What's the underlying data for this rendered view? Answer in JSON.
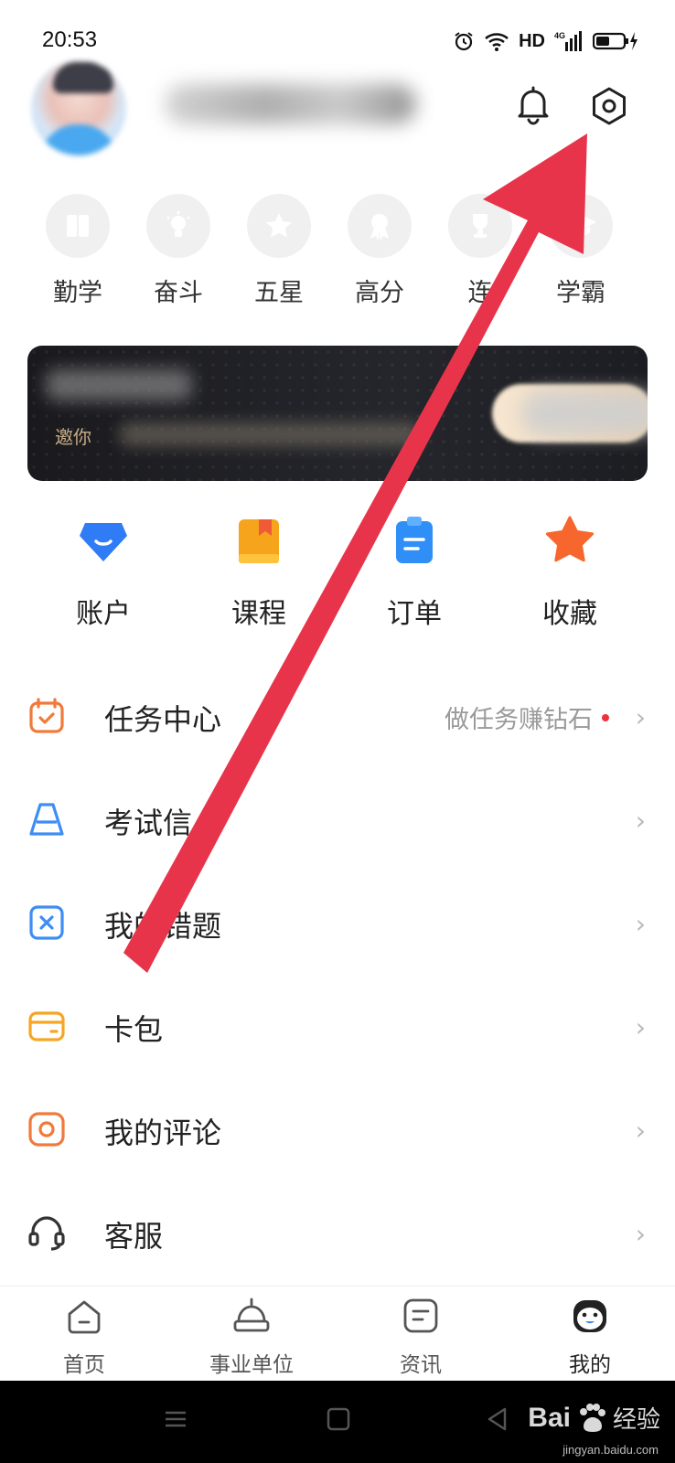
{
  "status_bar": {
    "time": "20:53",
    "network": "HD",
    "icons": [
      "alarm-icon",
      "wifi-icon",
      "signal-icon",
      "battery-charging-icon"
    ]
  },
  "header": {
    "avatar": "avatar-blurred",
    "username": "",
    "icons": [
      "bell-icon",
      "settings-hexagon-icon"
    ]
  },
  "badges": [
    {
      "label": "勤学",
      "icon": "book-icon"
    },
    {
      "label": "奋斗",
      "icon": "lightbulb-icon"
    },
    {
      "label": "五星",
      "icon": "star-icon"
    },
    {
      "label": "高分",
      "icon": "award-ribbon-icon"
    },
    {
      "label": "连",
      "icon": "trophy-icon"
    },
    {
      "label": "学霸",
      "icon": "graduation-cap-icon"
    }
  ],
  "vip_banner": {
    "subtitle_prefix": "邀你"
  },
  "quick_actions": [
    {
      "label": "账户",
      "icon": "wallet-shield-icon",
      "color": "#2f7cf6"
    },
    {
      "label": "课程",
      "icon": "book-bookmark-icon",
      "color": "#f7a41d"
    },
    {
      "label": "订单",
      "icon": "clipboard-icon",
      "color": "#2f8ff7"
    },
    {
      "label": "收藏",
      "icon": "star-icon",
      "color": "#f7662d"
    }
  ],
  "menu": [
    {
      "label": "任务中心",
      "hint": "做任务赚钻石",
      "icon": "calendar-check-icon",
      "color": "#f07a3a"
    },
    {
      "label": "考试信",
      "hint": "",
      "icon": "bell-shape-icon",
      "color": "#3d8df5"
    },
    {
      "label": "我的错题",
      "hint": "",
      "icon": "error-x-icon",
      "color": "#3d8df5"
    },
    {
      "label": "卡包",
      "hint": "",
      "icon": "card-wallet-icon",
      "color": "#f5a623"
    },
    {
      "label": "我的评论",
      "hint": "",
      "icon": "comment-circle-icon",
      "color": "#f07a3a"
    },
    {
      "label": "客服",
      "hint": "",
      "icon": "headset-icon",
      "color": "#333333"
    }
  ],
  "tabs": [
    {
      "label": "首页",
      "icon": "home-icon",
      "active": false
    },
    {
      "label": "事业单位",
      "icon": "building-icon",
      "active": false
    },
    {
      "label": "资讯",
      "icon": "news-icon",
      "active": false
    },
    {
      "label": "我的",
      "icon": "profile-face-icon",
      "active": true
    }
  ],
  "watermark": {
    "brand": "Bai",
    "brand_cn": "经验",
    "url": "jingyan.baidu.com"
  },
  "colors": {
    "annotation_arrow": "#e8344a",
    "accent_blue": "#2f7cf6",
    "notification_dot": "#f0313b"
  }
}
